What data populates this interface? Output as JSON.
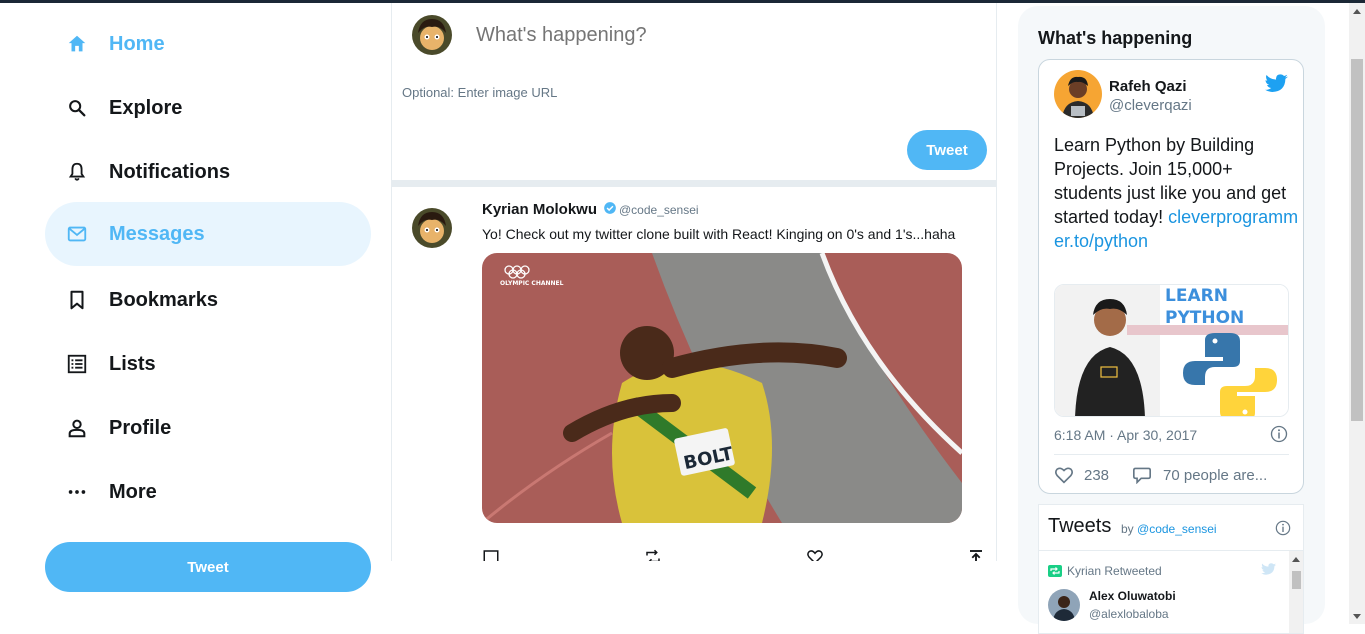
{
  "sidebar": {
    "items": [
      {
        "label": "Home",
        "icon": "home-icon"
      },
      {
        "label": "Explore",
        "icon": "search-icon"
      },
      {
        "label": "Notifications",
        "icon": "bell-icon"
      },
      {
        "label": "Messages",
        "icon": "mail-icon"
      },
      {
        "label": "Bookmarks",
        "icon": "bookmark-icon"
      },
      {
        "label": "Lists",
        "icon": "list-icon"
      },
      {
        "label": "Profile",
        "icon": "person-icon"
      },
      {
        "label": "More",
        "icon": "more-icon"
      }
    ],
    "tweet_label": "Tweet"
  },
  "compose": {
    "placeholder": "What's happening?",
    "image_placeholder": "Optional: Enter image URL",
    "tweet_label": "Tweet"
  },
  "post": {
    "name": "Kyrian Molokwu",
    "handle": "@code_sensei",
    "text": "Yo! Check out my twitter clone built with React! Kinging on 0's and 1's...haha",
    "image_caption": "BOLT",
    "image_watermark": "OLYMPIC CHANNEL"
  },
  "widgets": {
    "title": "What's happening",
    "card": {
      "name": "Rafeh Qazi",
      "handle": "@cleverqazi",
      "text": "Learn Python by Building Projects. Join 15,000+ students just like you and get started today!",
      "link": "cleverprogrammer.to/python",
      "media_text_1": "LEARN",
      "media_text_2": "PYTHON",
      "time": "6:18 AM · Apr 30, 2017",
      "likes": "238",
      "replies": "70 people are..."
    },
    "timeline": {
      "title": "Tweets",
      "by": "by",
      "by_handle": "@code_sensei",
      "retweet_label": "Kyrian Retweeted",
      "rt_name": "Alex Oluwatobi",
      "rt_handle": "@alexlobaloba"
    }
  },
  "colors": {
    "accent": "#50b7f5",
    "active_bg": "#e8f5fe",
    "link": "#1b95e0",
    "muted": "#657786"
  }
}
